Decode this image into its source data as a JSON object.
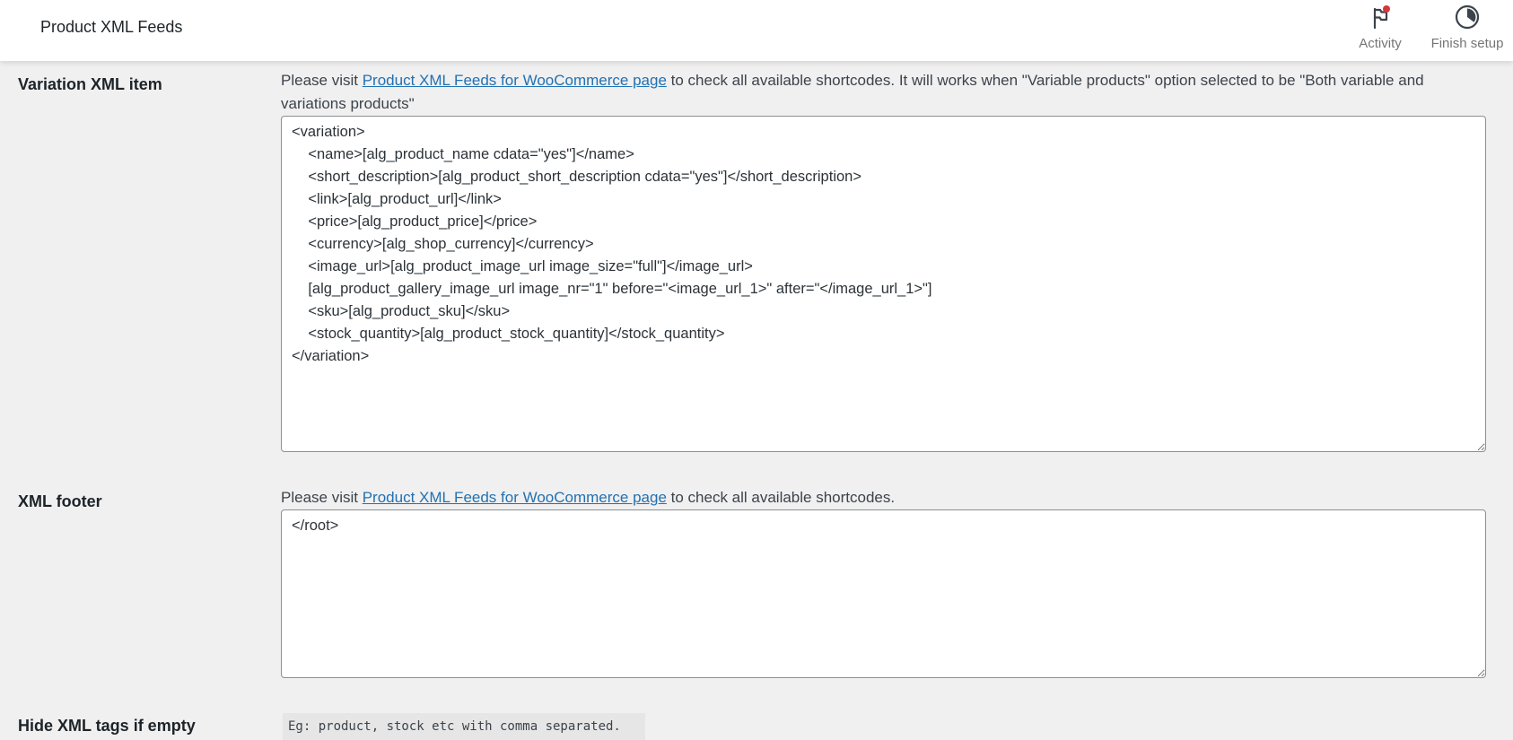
{
  "header": {
    "title": "Product XML Feeds",
    "activity_label": "Activity",
    "finish_setup_label": "Finish setup",
    "activity_badge_color": "#d63638"
  },
  "variation_item": {
    "label": "Variation XML item",
    "desc_prefix": "Please visit ",
    "desc_link": "Product XML Feeds for WooCommerce page",
    "desc_suffix": " to check all available shortcodes. It will works when \"Variable products\" option selected to be \"Both variable and variations products\"",
    "value": "<variation>\n\t<name>[alg_product_name cdata=\"yes\"]</name>\n\t<short_description>[alg_product_short_description cdata=\"yes\"]</short_description>\n\t<link>[alg_product_url]</link>\n\t<price>[alg_product_price]</price>\n\t<currency>[alg_shop_currency]</currency>\n\t<image_url>[alg_product_image_url image_size=\"full\"]</image_url>\n\t[alg_product_gallery_image_url image_nr=\"1\" before=\"<image_url_1>\" after=\"</image_url_1>\"]\n\t<sku>[alg_product_sku]</sku>\n\t<stock_quantity>[alg_product_stock_quantity]</stock_quantity>\n</variation>"
  },
  "xml_footer": {
    "label": "XML footer",
    "desc_prefix": "Please visit ",
    "desc_link": "Product XML Feeds for WooCommerce page",
    "desc_suffix": " to check all available shortcodes.",
    "value": "</root>"
  },
  "hide_tags": {
    "label": "Hide XML tags if empty",
    "placeholder": "Eg: product, stock etc with comma separated."
  }
}
